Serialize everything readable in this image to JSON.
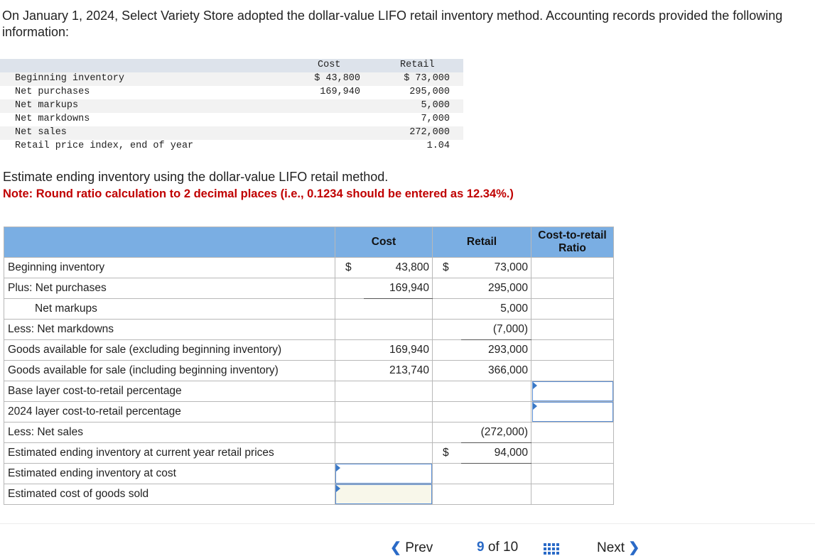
{
  "intro": "On January 1, 2024, Select Variety Store adopted the dollar-value LIFO retail inventory method. Accounting records provided the following information:",
  "given": {
    "headers": {
      "cost": "Cost",
      "retail": "Retail"
    },
    "rows": [
      {
        "label": "Beginning inventory",
        "cost": "$ 43,800",
        "retail": "$ 73,000"
      },
      {
        "label": "Net purchases",
        "cost": "169,940",
        "retail": "295,000"
      },
      {
        "label": "Net markups",
        "cost": "",
        "retail": "5,000"
      },
      {
        "label": "Net markdowns",
        "cost": "",
        "retail": "7,000"
      },
      {
        "label": "Net sales",
        "cost": "",
        "retail": "272,000"
      },
      {
        "label": "Retail price index, end of year",
        "cost": "",
        "retail": "1.04"
      }
    ]
  },
  "instruction": "Estimate ending inventory using the dollar-value LIFO retail method.",
  "note": "Note: Round ratio calculation to 2 decimal places (i.e., 0.1234 should be entered as 12.34%.)",
  "answer": {
    "headers": {
      "cost": "Cost",
      "retail": "Retail",
      "ratio_line1": "Cost-to-retail",
      "ratio_line2": "Ratio"
    },
    "rows": [
      {
        "label": "Beginning inventory",
        "cost_dollar": "$",
        "cost": "43,800",
        "retail_dollar": "$",
        "retail": "73,000"
      },
      {
        "label": "Plus: Net purchases",
        "cost": "169,940",
        "retail": "295,000"
      },
      {
        "label": "Net markups",
        "retail": "5,000"
      },
      {
        "label": "Less: Net markdowns",
        "retail": "(7,000)"
      },
      {
        "label": "Goods available for sale (excluding beginning inventory)",
        "cost": "169,940",
        "retail": "293,000"
      },
      {
        "label": "Goods available for sale (including beginning inventory)",
        "cost": "213,740",
        "retail": "366,000"
      },
      {
        "label": "Base layer cost-to-retail percentage"
      },
      {
        "label": "2024 layer cost-to-retail percentage"
      },
      {
        "label": "Less: Net sales",
        "retail": "(272,000)"
      },
      {
        "label": "Estimated ending inventory at current year retail prices",
        "retail_dollar": "$",
        "retail": "94,000"
      },
      {
        "label": "Estimated ending inventory at cost"
      },
      {
        "label": "Estimated cost of goods sold"
      }
    ]
  },
  "nav": {
    "prev": "Prev",
    "page_current": "9",
    "page_of": "of",
    "page_total": "10",
    "next": "Next"
  },
  "icons": {
    "prev": "chevron-left-icon",
    "next": "chevron-right-icon",
    "grid": "grid-icon"
  },
  "colors": {
    "accent": "#2a6ac7",
    "header": "#7aaee3",
    "note": "#c00000"
  }
}
